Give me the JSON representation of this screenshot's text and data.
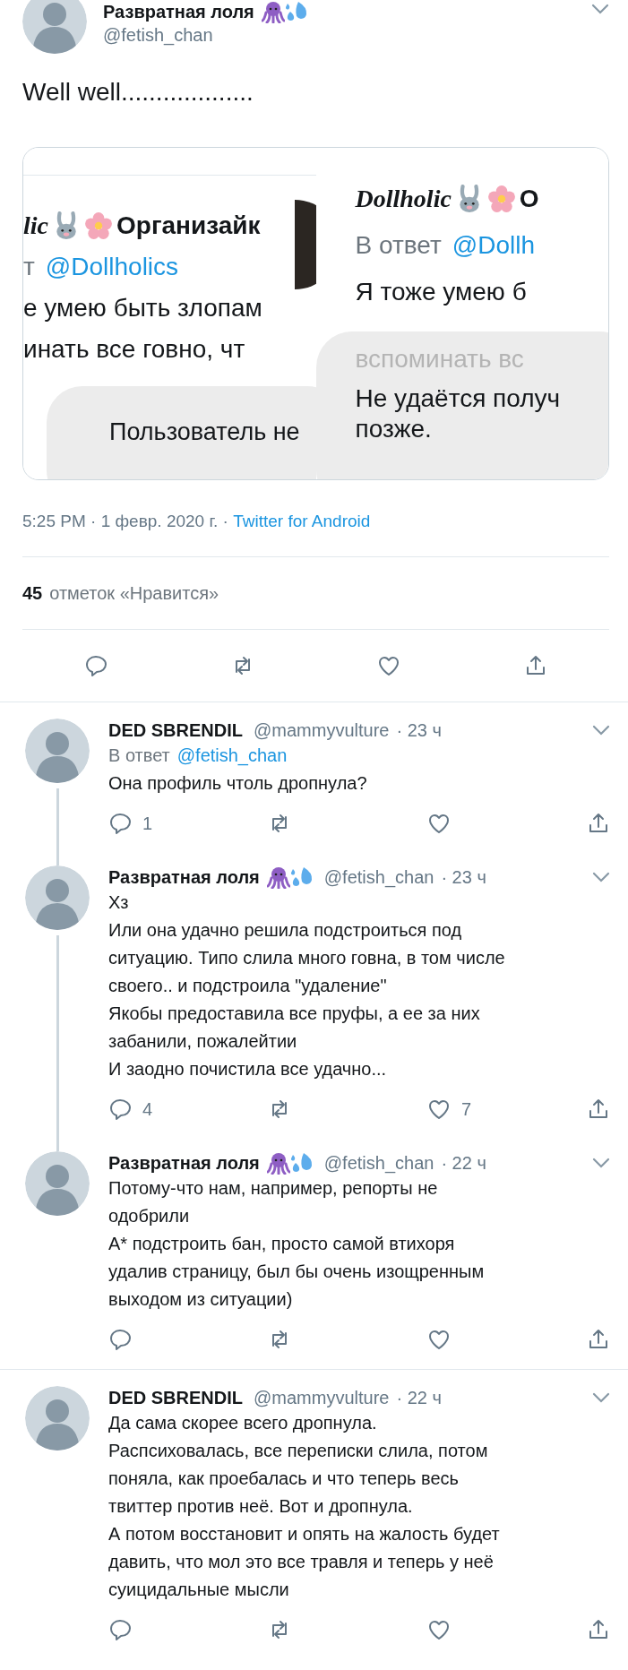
{
  "main_tweet": {
    "author": {
      "name": "Развратная лоля",
      "emoji_badges": true,
      "handle": "@fetish_chan"
    },
    "text": "Well well...................",
    "card": {
      "panels": [
        {
          "lines": [
            {
              "kind": "header",
              "script": "lic",
              "name": "Организайк"
            },
            {
              "kind": "reply_to",
              "prefix": "т",
              "handle": "@Dollholics"
            },
            {
              "kind": "text",
              "text": "е умею быть злопам"
            },
            {
              "kind": "text",
              "text": "инать все говно, чт"
            }
          ],
          "overlay": [
            {
              "kind": "notice",
              "text": "Пользователь не"
            }
          ]
        },
        {
          "lines": [
            {
              "kind": "header",
              "script": "Dollholic",
              "name": "О"
            },
            {
              "kind": "reply_to",
              "prefix": "В ответ",
              "handle": "@Dollh"
            },
            {
              "kind": "text",
              "text": "Я тоже умею б"
            }
          ],
          "overlay": [
            {
              "kind": "faded",
              "text": "вспоминать вс"
            },
            {
              "kind": "text",
              "text": "Не удаётся получ"
            },
            {
              "kind": "text",
              "text": "позже."
            }
          ]
        }
      ]
    },
    "timestamp": "5:25 PM · 1 февр. 2020 г. · ",
    "source": "Twitter for Android",
    "likes_count": "45",
    "likes_label": "отметок «Нравится»",
    "actions": [
      {
        "kind": "reply"
      },
      {
        "kind": "retweet"
      },
      {
        "kind": "like"
      },
      {
        "kind": "share"
      }
    ]
  },
  "replies": [
    {
      "author": {
        "name": "DED SBRENDIL",
        "handle": "@mammyvulture"
      },
      "time": "· 23 ч",
      "reply_to_label": "В ответ",
      "reply_to": "@fetish_chan",
      "thread_line": true,
      "lines": [
        "Она профиль чтоль дропнула?"
      ],
      "actions": [
        {
          "kind": "reply",
          "count": "1"
        },
        {
          "kind": "retweet"
        },
        {
          "kind": "like"
        },
        {
          "kind": "share"
        }
      ]
    },
    {
      "author": {
        "name": "Развратная лоля",
        "emoji_badges": true,
        "handle": "@fetish_chan"
      },
      "time": "· 23 ч",
      "thread_line": true,
      "lines": [
        "Хз",
        "Или она удачно решила подстроиться под",
        "ситуацию. Типо слила много говна, в том числе",
        "своего.. и подстроила \"удаление\"",
        "Якобы предоставила все пруфы, а ее за них",
        "забанили, пожалейтии",
        "И заодно почистила все удачно..."
      ],
      "actions": [
        {
          "kind": "reply",
          "count": "4"
        },
        {
          "kind": "retweet"
        },
        {
          "kind": "like",
          "count": "7"
        },
        {
          "kind": "share"
        }
      ]
    },
    {
      "author": {
        "name": "Развратная лоля",
        "emoji_badges": true,
        "handle": "@fetish_chan"
      },
      "time": "· 22 ч",
      "thread_line": false,
      "lines": [
        "Потому-что  нам, например, репорты не",
        "одобрили",
        "А* подстроить бан, просто самой втихоря",
        "удалив страницу, был бы очень изощренным",
        "выходом из ситуации)"
      ],
      "actions": [
        {
          "kind": "reply"
        },
        {
          "kind": "retweet"
        },
        {
          "kind": "like"
        },
        {
          "kind": "share"
        }
      ]
    },
    {
      "author": {
        "name": "DED SBRENDIL",
        "handle": "@mammyvulture"
      },
      "time": "· 22 ч",
      "thread_line": false,
      "lines": [
        "Да сама скорее всего дропнула.",
        "Распсиховалась, все переписки слила, потом",
        "поняла, как проебалась и  что теперь весь",
        "твиттер против неё. Вот и дропнула.",
        "А потом восстановит и опять на жалость будет",
        "давить, что мол это все травля и теперь у неё",
        "суицидальные мысли"
      ],
      "actions": [
        {
          "kind": "reply"
        },
        {
          "kind": "retweet"
        },
        {
          "kind": "like"
        },
        {
          "kind": "share"
        }
      ]
    }
  ]
}
